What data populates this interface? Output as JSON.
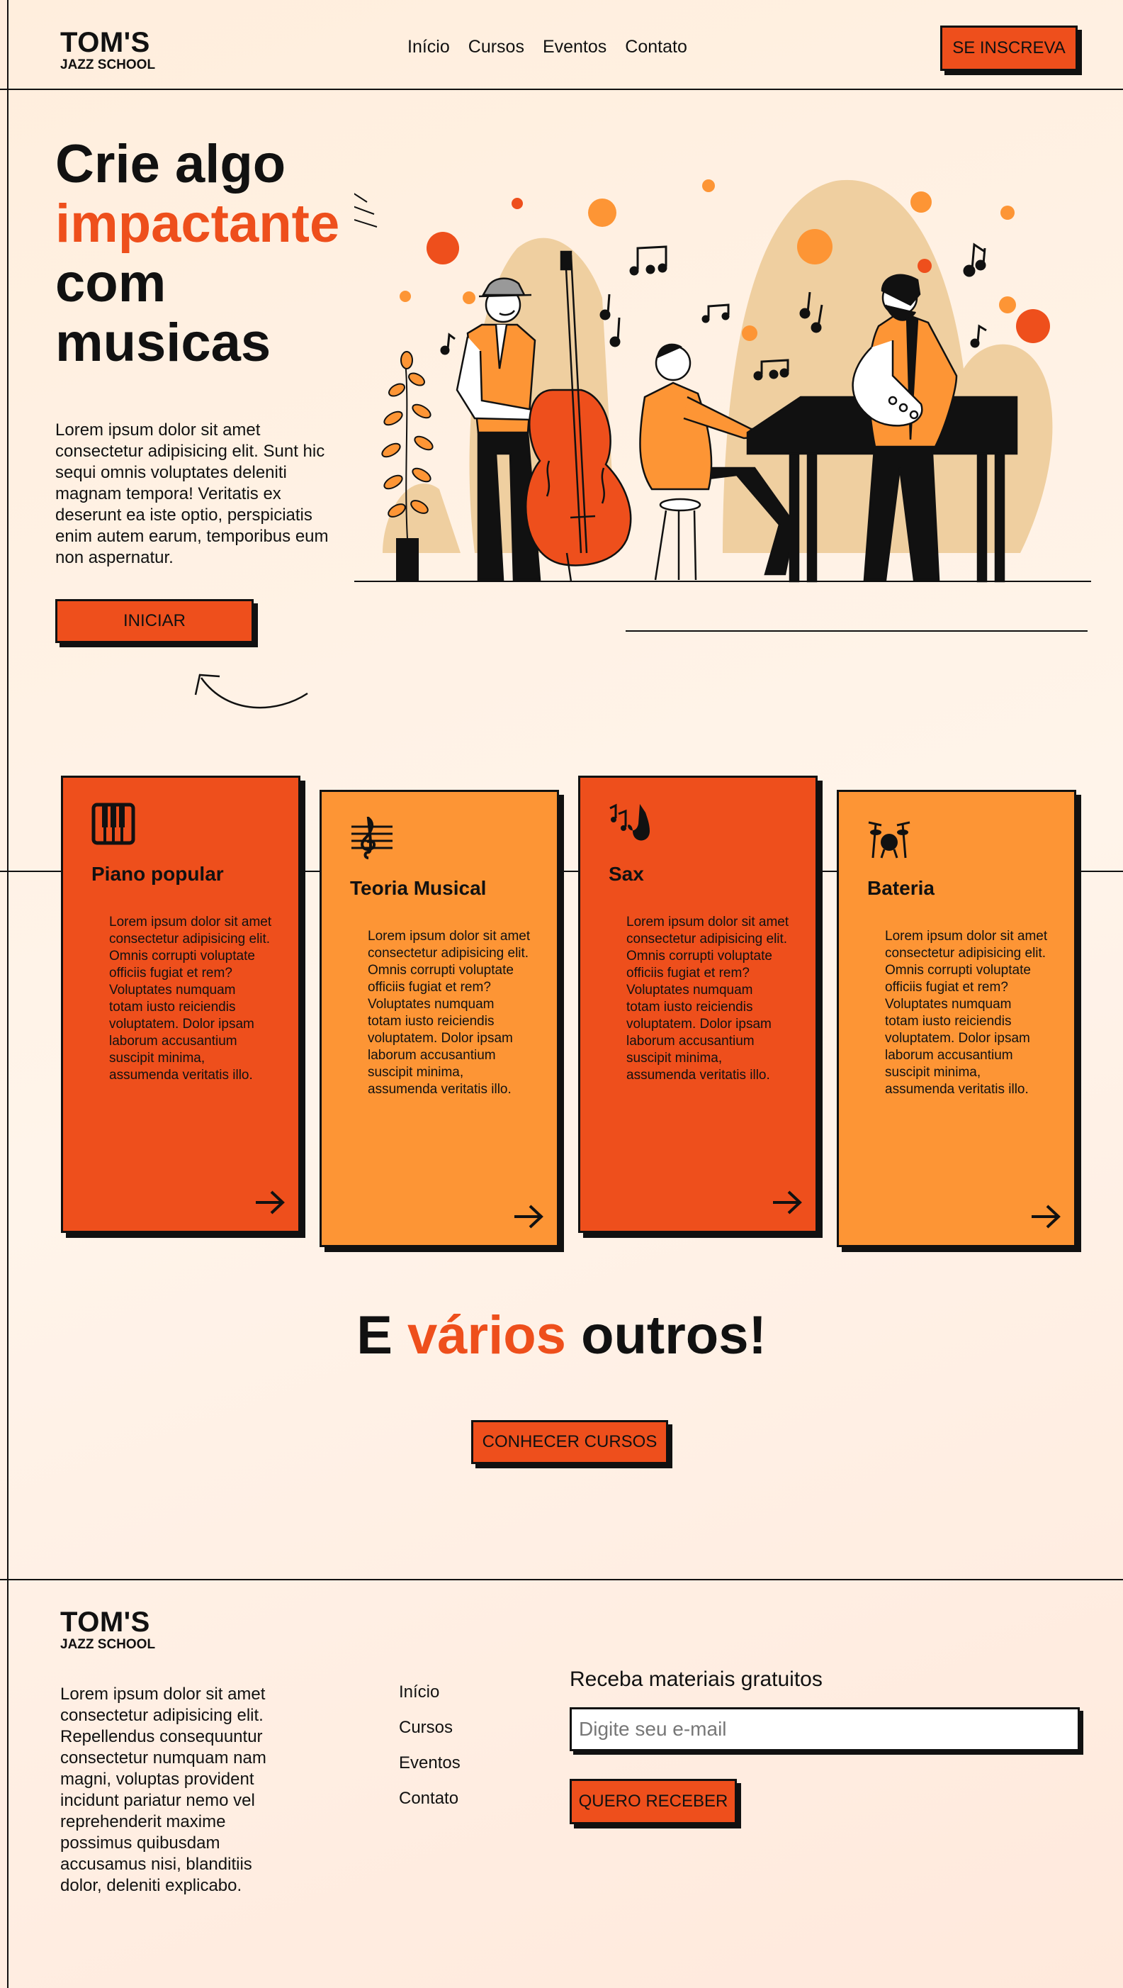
{
  "brand": {
    "name": "TOM'S",
    "tagline": "JAZZ SCHOOL"
  },
  "nav": {
    "items": [
      "Início",
      "Cursos",
      "Eventos",
      "Contato"
    ]
  },
  "header": {
    "cta_label": "SE INSCREVA"
  },
  "hero": {
    "title_line1": "Crie algo",
    "title_accent": "impactante",
    "title_line3": "com",
    "title_line4": "musicas",
    "text": "Lorem ipsum dolor sit amet consectetur adipisicing elit. Sunt hic sequi omnis voluptates deleniti magnam tempora! Veritatis ex deserunt ea iste optio, perspiciatis enim autem earum, temporibus eum non aspernatur.",
    "button_label": "INICIAR"
  },
  "courses": [
    {
      "title": "Piano popular",
      "icon": "piano-keys-icon",
      "text": "Lorem ipsum dolor sit amet consectetur adipisicing elit. Omnis corrupti voluptate officiis fugiat et rem? Voluptates numquam totam iusto reiciendis voluptatem. Dolor ipsam laborum accusantium suscipit minima, assumenda veritatis illo."
    },
    {
      "title": "Teoria Musical",
      "icon": "treble-clef-icon",
      "text": "Lorem ipsum dolor sit amet consectetur adipisicing elit. Omnis corrupti voluptate officiis fugiat et rem? Voluptates numquam totam iusto reiciendis voluptatem. Dolor ipsam laborum accusantium suscipit minima, assumenda veritatis illo."
    },
    {
      "title": "Sax",
      "icon": "saxophone-icon",
      "text": "Lorem ipsum dolor sit amet consectetur adipisicing elit. Omnis corrupti voluptate officiis fugiat et rem? Voluptates numquam totam iusto reiciendis voluptatem. Dolor ipsam laborum accusantium suscipit minima, assumenda veritatis illo."
    },
    {
      "title": "Bateria",
      "icon": "drum-kit-icon",
      "text": "Lorem ipsum dolor sit amet consectetur adipisicing elit. Omnis corrupti voluptate officiis fugiat et rem? Voluptates numquam totam iusto reiciendis voluptatem. Dolor ipsam laborum accusantium suscipit minima, assumenda veritatis illo."
    }
  ],
  "more": {
    "prefix": "E",
    "accent": "vários",
    "suffix": "outros!",
    "button_label": "CONHECER CURSOS"
  },
  "footer": {
    "text": "Lorem ipsum dolor sit amet consectetur adipisicing elit. Repellendus consequuntur consectetur numquam nam magni, voluptas provident incidunt pariatur nemo vel reprehenderit maxime possimus quibusdam accusamus nisi, blanditiis dolor, deleniti explicabo.",
    "nav": [
      "Início",
      "Cursos",
      "Eventos",
      "Contato"
    ],
    "newsletter_title": "Receba materiais gratuitos",
    "email_placeholder": "Digite seu e-mail",
    "button_label": "QUERO RECEBER"
  },
  "colors": {
    "accent_red": "#ee4f1c",
    "accent_orange": "#fd9535",
    "background": "#fff1e6",
    "illustration_beige": "#efcfa0"
  }
}
